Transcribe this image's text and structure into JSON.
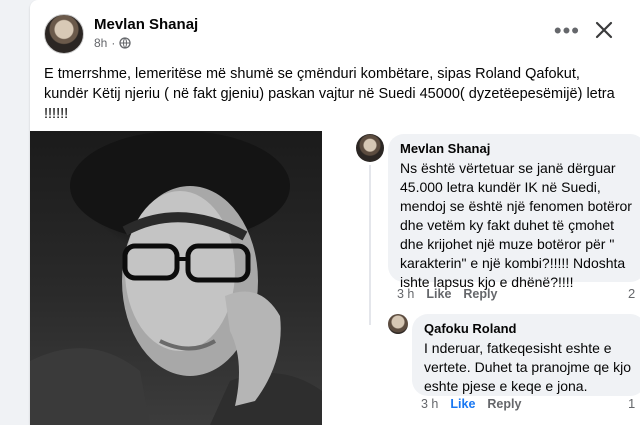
{
  "post": {
    "author": "Mevlan Shanaj",
    "time": "8h",
    "dot": "·",
    "more": "•••",
    "text": "E tmerrshme, lemeritëse më shumë se  çmënduri kombëtare, sipas Roland Qafokut, kundër Këtij njeriu ( në fakt gjeniu) paskan vajtur në Suedi 45000( dyzetëepesëmijë) letra !!!!!!"
  },
  "comments": [
    {
      "author": "Mevlan Shanaj",
      "text": "Ns është vërtetuar se janë dërguar 45.000 letra kundër IK në Suedi, mendoj se është një fenomen botëror dhe vetëm ky fakt duhet të çmohet dhe krijohet një muze botëror për \" karakterin\" e një kombi?!!!!! Ndoshta ishte lapsus kjo e dhënë?!!!!",
      "time": "3 h",
      "like": "Like",
      "reply": "Reply",
      "reactions": "2"
    },
    {
      "author": "Qafoku Roland",
      "text": "I nderuar, fatkeqesisht eshte e vertete. Duhet ta pranojme qe kjo eshte pjese e keqe e jona.",
      "time": "3 h",
      "like": "Like",
      "reply": "Reply",
      "reactions": "1"
    }
  ],
  "icons": {
    "globe": "globe-icon",
    "close": "close-icon",
    "more": "more-options-icon",
    "like": "thumbs-up-icon"
  },
  "colors": {
    "accent": "#1877f2",
    "secondary_text": "#65676b",
    "bubble": "#f0f2f5"
  }
}
